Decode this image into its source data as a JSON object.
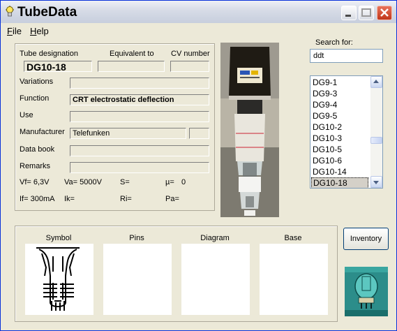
{
  "window": {
    "title": "TubeData"
  },
  "menu": [
    {
      "label": "File",
      "accel": "F",
      "rest": "ile"
    },
    {
      "label": "Help",
      "accel": "H",
      "rest": "elp"
    }
  ],
  "form": {
    "tube_designation_label": "Tube designation",
    "equivalent_label": "Equivalent to",
    "cv_number_label": "CV number",
    "tube_designation": "DG10-18",
    "equivalent": "",
    "cv_number": "",
    "variations_label": "Variations",
    "variations": "",
    "function_label": "Function",
    "function": "CRT electrostatic deflection",
    "use_label": "Use",
    "use": "",
    "manufacturer_label": "Manufacturer",
    "manufacturer": "Telefunken",
    "manufacturer_extra": "",
    "data_book_label": "Data book",
    "data_book": "",
    "remarks_label": "Remarks",
    "remarks": ""
  },
  "specs": {
    "vf": "Vf= 6,3V",
    "va": "Va= 5000V",
    "s": "S=",
    "mu": "µ=",
    "mu_value": "0",
    "if": "If= 300mA",
    "ik": "Ik=",
    "ri": "Ri=",
    "pa": "Pa="
  },
  "search": {
    "label": "Search for:",
    "value": "ddt"
  },
  "tube_list": {
    "items": [
      "DG9-1",
      "DG9-3",
      "DG9-4",
      "DG9-5",
      "DG10-2",
      "DG10-3",
      "DG10-5",
      "DG10-6",
      "DG10-14",
      "DG10-18"
    ],
    "selected": "DG10-18"
  },
  "panels": {
    "symbol": "Symbol",
    "pins": "Pins",
    "diagram": "Diagram",
    "base": "Base"
  },
  "inventory_button": "Inventory",
  "colors": {
    "title_gradient_top": "#eef0f6",
    "close_button": "#c1361a",
    "window_bg": "#ece9d8",
    "list_selected": "#d4d0c8"
  }
}
